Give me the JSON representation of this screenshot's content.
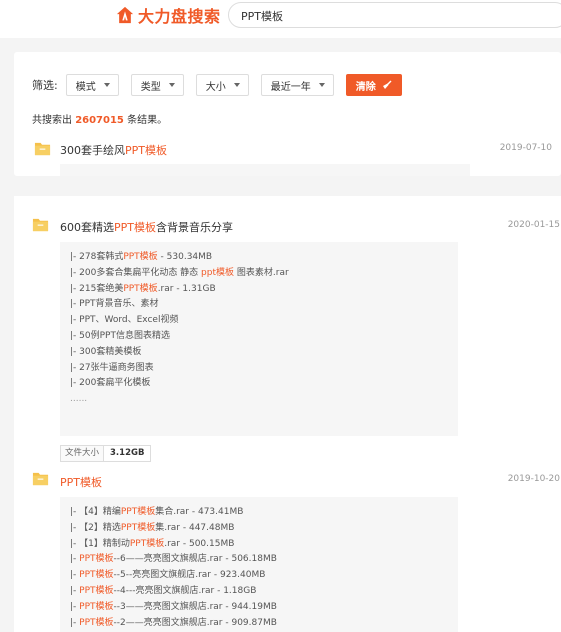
{
  "header": {
    "logo_text": "大力盘搜索",
    "search_value": "PPT模板"
  },
  "filters": {
    "label": "筛选:",
    "options": [
      "模式",
      "类型",
      "大小",
      "最近一年"
    ],
    "clear_label": "清除"
  },
  "summary": {
    "prefix": "共搜索出",
    "count": "2607015",
    "suffix": "条结果。"
  },
  "results": [
    {
      "title_parts": [
        "300套手绘风",
        "PPT模板",
        ""
      ],
      "date": "2019-07-10"
    },
    {
      "title_parts": [
        "600套精选",
        "PPT模板",
        "含背景音乐分享"
      ],
      "date": "2020-01-15",
      "files": [
        [
          "|- 278套韩式",
          "PPT模板",
          " - 530.34MB"
        ],
        [
          "|- 200多套合集扁平化动态 静态 ",
          "ppt模板",
          " 图表素材.rar"
        ],
        [
          "|- 215套绝美",
          "PPT模板",
          ".rar - 1.31GB"
        ],
        [
          "|- PPT背景音乐、素材",
          "",
          ""
        ],
        [
          "|- PPT、Word、Excel视频",
          "",
          ""
        ],
        [
          "|- 50例PPT信息图表精选",
          "",
          ""
        ],
        [
          "|- 300套精美模板",
          "",
          ""
        ],
        [
          "|- 27张牛逼商务图表",
          "",
          ""
        ],
        [
          "|- 200套扁平化模板",
          "",
          ""
        ]
      ],
      "ellipsis": "......",
      "size_label": "文件大小",
      "size_value": "3.12GB"
    },
    {
      "title_parts": [
        "",
        "PPT模板",
        ""
      ],
      "date": "2019-10-20",
      "files": [
        [
          "|- 【4】精编",
          "PPT模板",
          "集合.rar - 473.41MB"
        ],
        [
          "|- 【2】精选",
          "PPT模板",
          "集.rar - 447.48MB"
        ],
        [
          "|- 【1】精制动",
          "PPT模板",
          ".rar - 500.15MB"
        ],
        [
          "|- ",
          "PPT模板",
          "--6——亮亮图文旗舰店.rar - 506.18MB"
        ],
        [
          "|- ",
          "PPT模板",
          "--5--亮亮图文旗舰店.rar - 923.40MB"
        ],
        [
          "|- ",
          "PPT模板",
          "--4---亮亮图文旗舰店.rar - 1.18GB"
        ],
        [
          "|- ",
          "PPT模板",
          "--3——亮亮图文旗舰店.rar - 944.19MB"
        ],
        [
          "|- ",
          "PPT模板",
          "--2——亮亮图文旗舰店.rar - 909.87MB"
        ]
      ]
    }
  ],
  "colors": {
    "accent": "#f05a28",
    "background": "#f4f4f4",
    "card": "#ffffff",
    "file_box": "#f6f6f6"
  }
}
